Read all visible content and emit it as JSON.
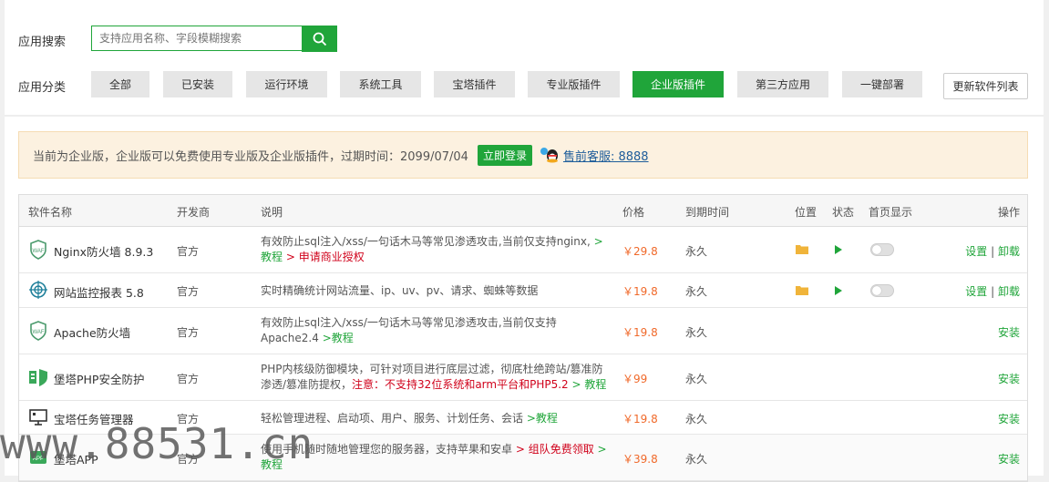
{
  "search": {
    "label": "应用搜索",
    "placeholder": "支持应用名称、字段模糊搜索"
  },
  "categories": {
    "label": "应用分类",
    "items": [
      "全部",
      "已安装",
      "运行环境",
      "系统工具",
      "宝塔插件",
      "专业版插件",
      "企业版插件",
      "第三方应用",
      "一键部署"
    ],
    "active": "企业版插件"
  },
  "refresh_label": "更新软件列表",
  "notice": {
    "text": "当前为企业版，企业版可以免费使用专业版及企业版插件，过期时间：2099/07/04",
    "login_label": "立即登录",
    "support_label": "售前客服: 8888"
  },
  "table": {
    "headers": {
      "name": "软件名称",
      "dev": "开发商",
      "desc": "说明",
      "price": "价格",
      "expire": "到期时间",
      "location": "位置",
      "status": "状态",
      "home": "首页显示",
      "ops": "操作"
    },
    "rows": [
      {
        "icon": "waf-shield-icon",
        "name": "Nginx防火墙 8.9.3",
        "dev": "官方",
        "desc": "有效防止sql注入/xss/一句话木马等常见渗透攻击,当前仅支持nginx,",
        "link1": "> 教程",
        "link2": "> 申请商业授权",
        "price": "￥29.8",
        "expire": "永久",
        "settings": "设置",
        "sep": "|",
        "uninstall": "卸载"
      },
      {
        "icon": "target-icon",
        "name": "网站监控报表 5.8",
        "dev": "官方",
        "desc": "实时精确统计网站流量、ip、uv、pv、请求、蜘蛛等数据",
        "price": "￥19.8",
        "expire": "永久",
        "settings": "设置",
        "sep": "|",
        "uninstall": "卸载"
      },
      {
        "icon": "waf-shield-icon",
        "name": "Apache防火墙",
        "dev": "官方",
        "desc": "有效防止sql注入/xss/一句话木马等常见渗透攻击,当前仅支持",
        "desc2": "Apache2.4",
        "link1": ">教程",
        "price": "￥19.8",
        "expire": "永久",
        "action": "安装"
      },
      {
        "icon": "php-shield-icon",
        "name": "堡塔PHP安全防护",
        "dev": "官方",
        "desc": "PHP内核级防御模块，可针对项目进行底层过滤，彻底杜绝跨站/篡准防",
        "desc2": "渗透/篡准防提权，",
        "warn": "注意：不支持32位系统和arm平台和PHP5.2",
        "link1": "> 教程",
        "price": "￥99",
        "expire": "永久",
        "action": "安装"
      },
      {
        "icon": "monitor-icon",
        "name": "宝塔任务管理器",
        "dev": "官方",
        "desc": "轻松管理进程、启动项、用户、服务、计划任务、会话",
        "link1": ">教程",
        "price": "￥19.8",
        "expire": "永久",
        "action": "安装"
      },
      {
        "icon": "app-icon",
        "name": "堡塔APP",
        "dev": "官方",
        "desc": "使用手机随时随地管理您的服务器，支持苹果和安卓",
        "link2": "> 组队免费领取",
        "link1": "> 教程",
        "price": "￥39.8",
        "expire": "永久",
        "action": "安装"
      }
    ]
  },
  "watermark": "www.88531.cn",
  "colors": {
    "accent": "#20a53a",
    "price": "#f0692a",
    "warn": "#d0021b",
    "notice_bg": "#fcf1e0"
  }
}
